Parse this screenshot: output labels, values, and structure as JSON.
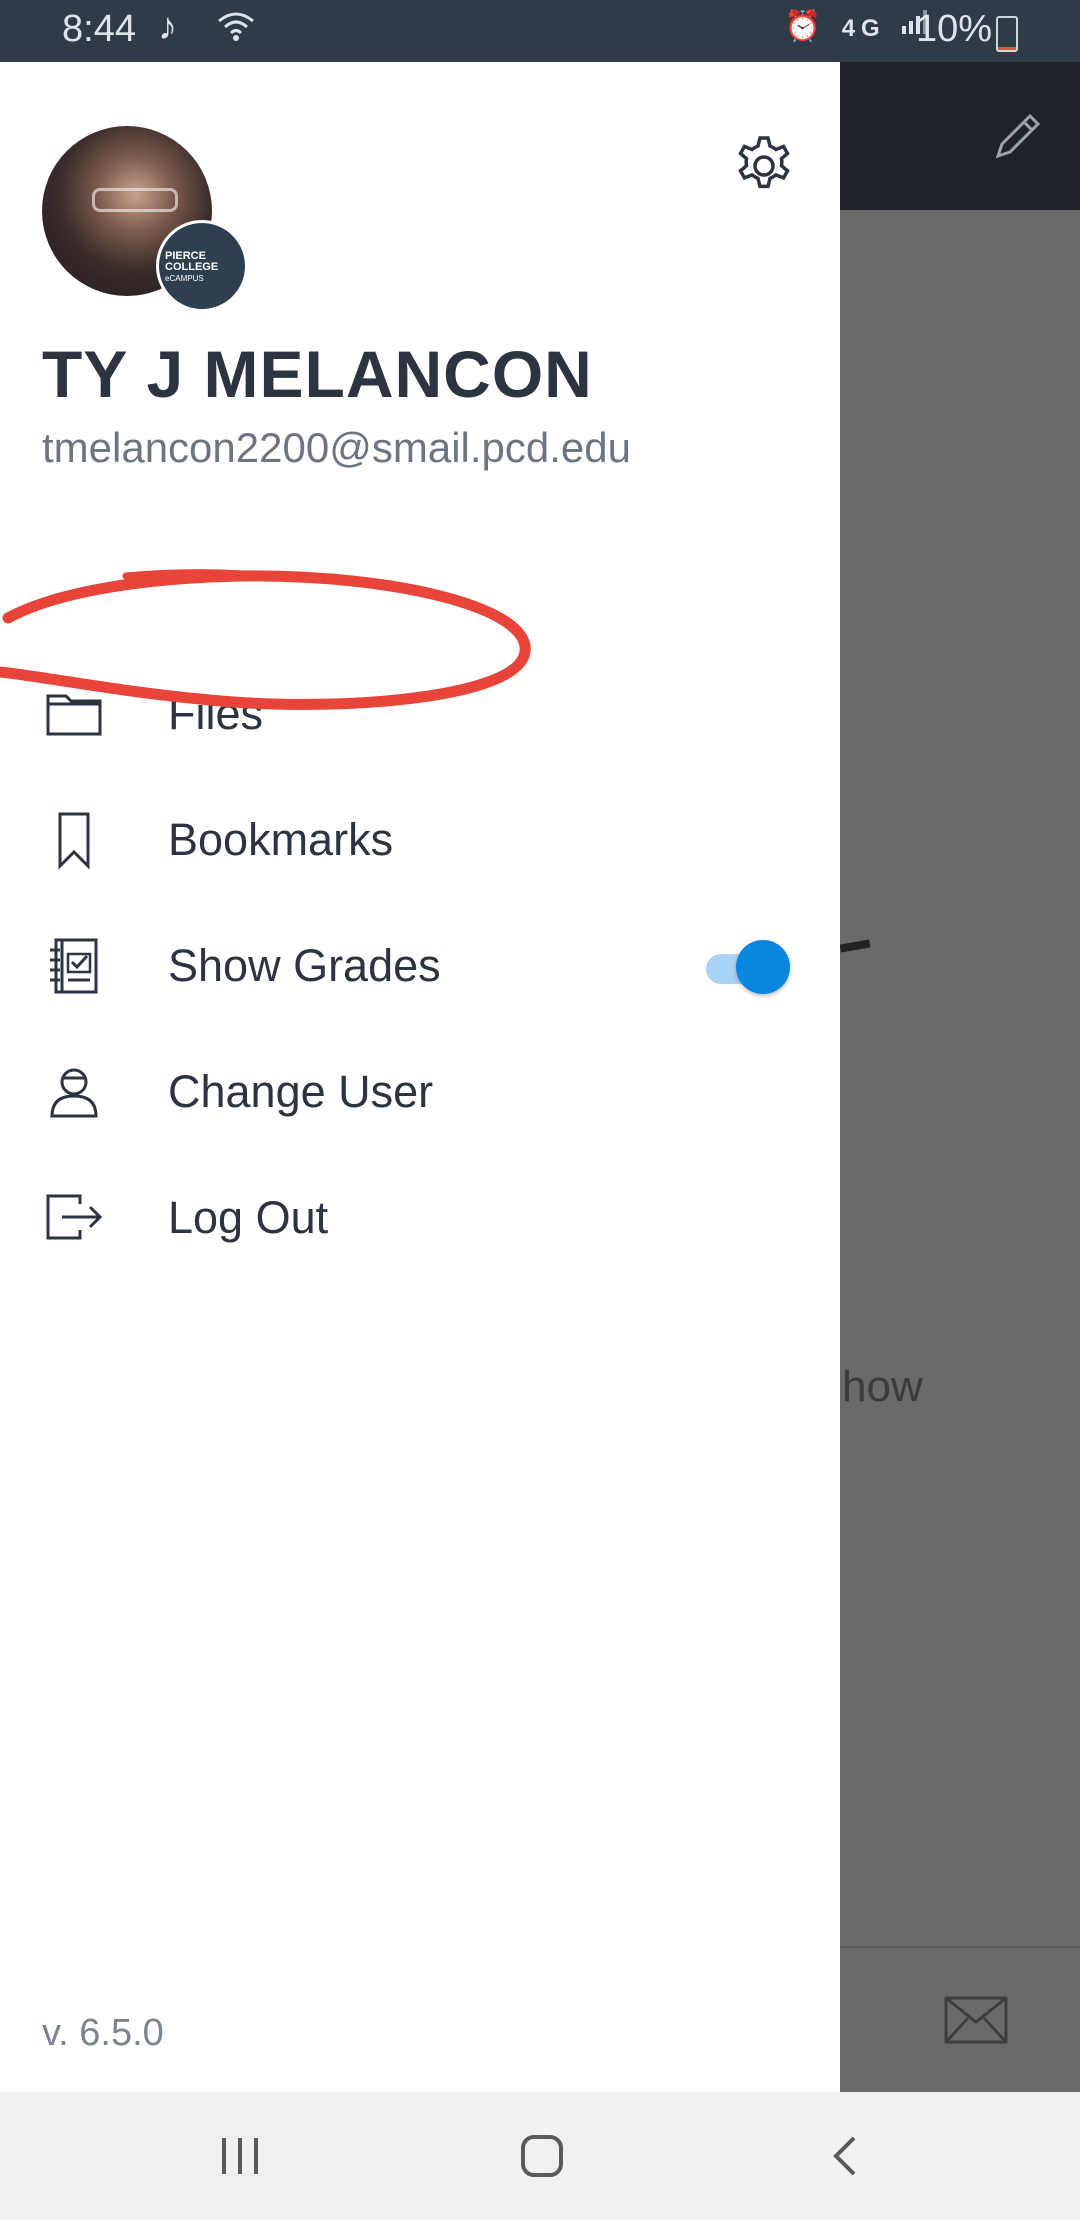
{
  "status_bar": {
    "time": "8:44",
    "left_icons": [
      "music-note-icon",
      "wifi-icon"
    ],
    "right_icons": [
      "alarm-icon",
      "4g-lte-icon",
      "signal-icon"
    ],
    "network_label": "4G",
    "battery_percent": "10%",
    "battery_level": 0.1,
    "battery_color": "#e2553f"
  },
  "drawer": {
    "user": {
      "name": "TY J MELANCON",
      "email": "tmelancon2200@smail.pcd.edu",
      "school_badge": [
        "PIERCE",
        "COLLEGE",
        "eCAMPUS"
      ]
    },
    "menu": [
      {
        "label": "Files",
        "icon": "folder-icon"
      },
      {
        "label": "Bookmarks",
        "icon": "bookmark-icon"
      },
      {
        "label": "Show Grades",
        "icon": "grades-notebook-icon",
        "toggle_on": true
      },
      {
        "label": "Change User",
        "icon": "user-icon"
      },
      {
        "label": "Log Out",
        "icon": "logout-icon"
      }
    ],
    "version": "v. 6.5.0"
  },
  "background_app": {
    "partial_text": "how"
  },
  "colors": {
    "accent": "#0a86e0",
    "annotation": "#e8443a",
    "text_primary": "#2b3440",
    "status_bar_bg": "#2f3b47"
  }
}
